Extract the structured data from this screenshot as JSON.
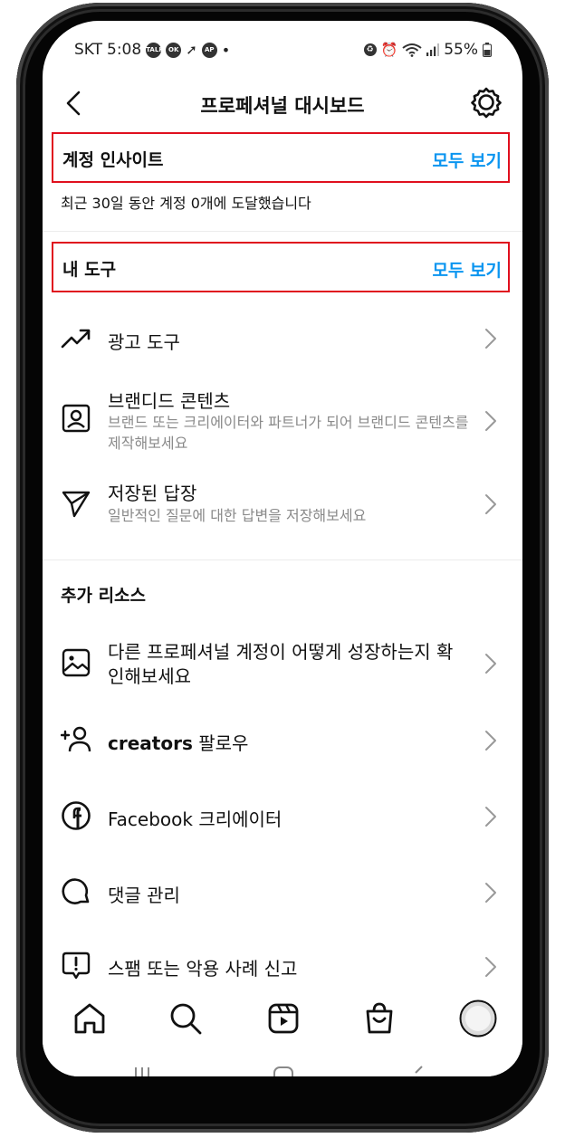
{
  "status": {
    "carrier": "SKT",
    "time": "5:08",
    "notif_icons": [
      "talk-icon",
      "ok-icon",
      "arrow-icon",
      "ap-icon"
    ],
    "battery": "55%"
  },
  "header": {
    "title": "프로페셔널 대시보드"
  },
  "insights": {
    "label": "계정 인사이트",
    "link": "모두 보기",
    "summary": "최근 30일 동안 계정 0개에 도달했습니다"
  },
  "tools": {
    "label": "내 도구",
    "link": "모두 보기",
    "items": [
      {
        "title": "광고 도구",
        "icon": "trending-up-icon"
      },
      {
        "title": "브랜디드 콘텐츠",
        "subtitle": "브랜드 또는 크리에이터와 파트너가 되어 브랜디드 콘텐츠를 제작해보세요",
        "icon": "profile-card-icon"
      },
      {
        "title": "저장된 답장",
        "subtitle": "일반적인 질문에 대한 답변을 저장해보세요",
        "icon": "send-icon"
      }
    ]
  },
  "resources": {
    "label": "추가 리소스",
    "items": [
      {
        "title": "다른 프로페셔널 계정이 어떻게 성장하는지 확인해보세요",
        "icon": "image-icon"
      },
      {
        "title_bold": "creators",
        "title": " 팔로우",
        "icon": "add-person-icon"
      },
      {
        "title": "Facebook 크리에이터",
        "icon": "facebook-icon"
      },
      {
        "title": "댓글 관리",
        "icon": "comment-icon"
      },
      {
        "title": "스팸 또는 악용 사례 신고",
        "icon": "report-icon"
      }
    ]
  },
  "tabs": [
    "home-icon",
    "search-icon",
    "reels-icon",
    "shop-icon",
    "profile-avatar"
  ]
}
